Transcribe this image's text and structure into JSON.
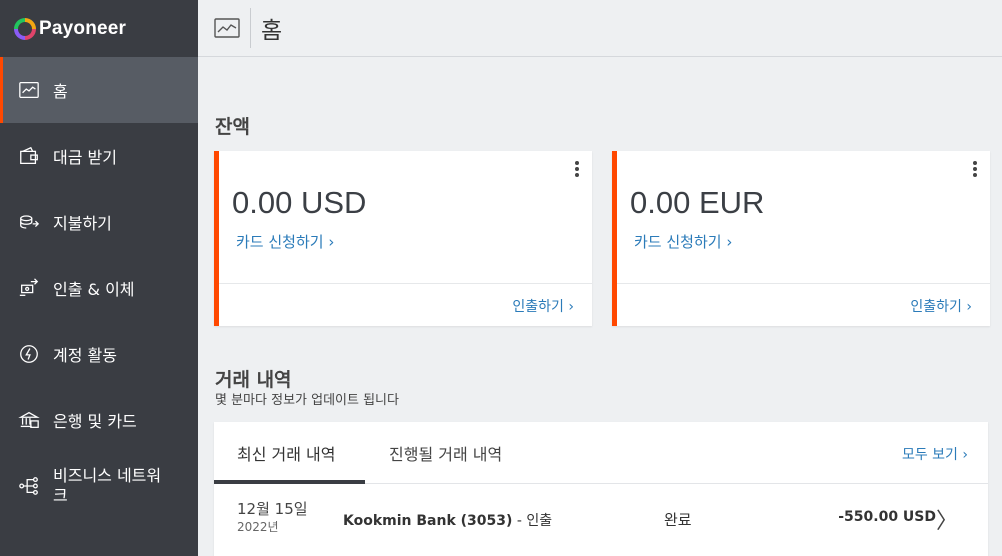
{
  "brand": {
    "logo_text": "Payoneer"
  },
  "header": {
    "title": "홈",
    "icon": "dashboard-chart-icon"
  },
  "sidebar": {
    "items": [
      {
        "label": "홈",
        "icon": "dashboard-chart-icon",
        "active": true
      },
      {
        "label": "대금 받기",
        "icon": "wallet-icon"
      },
      {
        "label": "지불하기",
        "icon": "coins-send-icon"
      },
      {
        "label": "인출 & 이체",
        "icon": "transfer-icon"
      },
      {
        "label": "계정 활동",
        "icon": "activity-icon"
      },
      {
        "label": "은행 및 카드",
        "icon": "bank-icon"
      },
      {
        "label": "비즈니스 네트워크",
        "icon": "network-icon"
      }
    ]
  },
  "balance": {
    "title": "잔액",
    "cards": [
      {
        "amount": "0.00 USD",
        "apply_link": "카드 신청하기 ›",
        "withdraw_link": "인출하기 ›"
      },
      {
        "amount": "0.00 EUR",
        "apply_link": "카드 신청하기 ›",
        "withdraw_link": "인출하기 ›"
      }
    ]
  },
  "transactions": {
    "title": "거래 내역",
    "subtitle": "몇 분마다 정보가 업데이트 됩니다",
    "tabs": [
      {
        "label": "최신 거래 내역",
        "active": true
      },
      {
        "label": "진행될 거래 내역",
        "active": false
      }
    ],
    "view_all": "모두 보기 ›",
    "rows": [
      {
        "date": "12월 15일",
        "year": "2022년",
        "desc_bold": "Kookmin Bank (3053)",
        "desc_rest": " - 인출",
        "status": "완료",
        "amount": "-550.00 USD"
      }
    ]
  },
  "colors": {
    "accent": "#ff4800",
    "sidebar_bg": "#3a3d43",
    "link": "#2b7bb9",
    "active_item_bg": "#575c64"
  }
}
